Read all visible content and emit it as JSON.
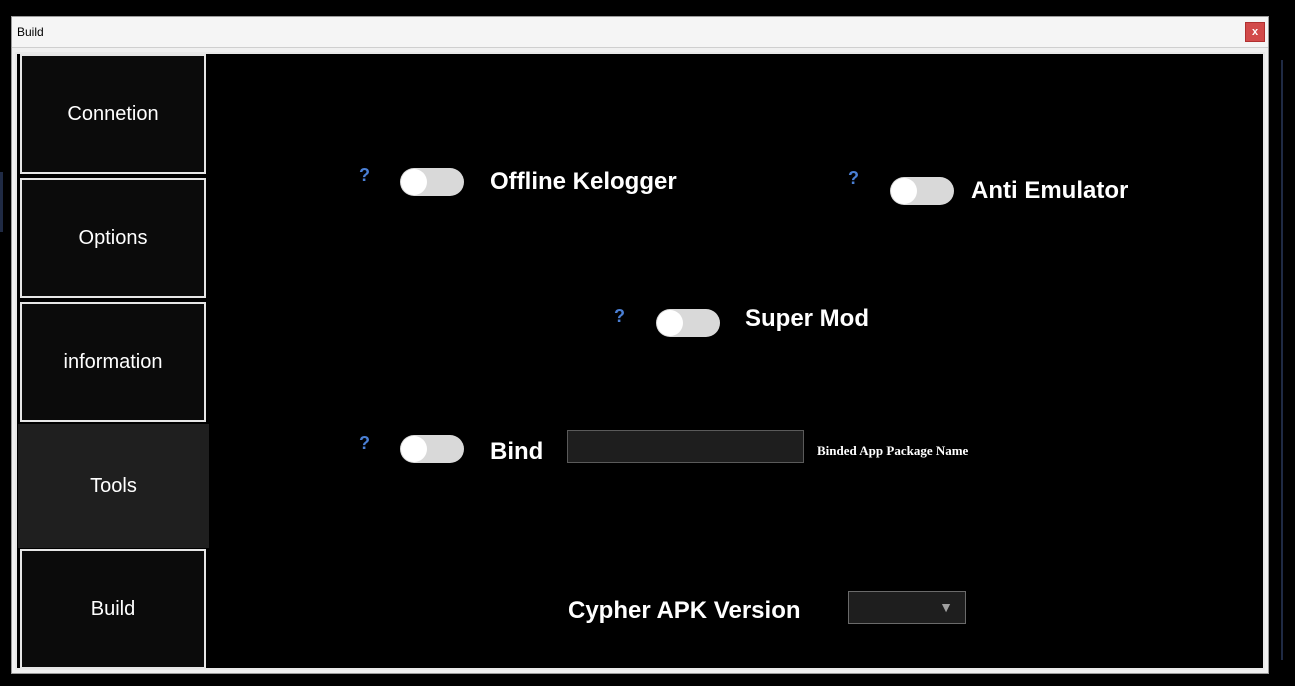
{
  "window": {
    "title": "Build",
    "close_label": "x"
  },
  "sidebar": {
    "items": [
      {
        "label": "Connetion",
        "active": false
      },
      {
        "label": "Options",
        "active": false
      },
      {
        "label": "information",
        "active": false
      },
      {
        "label": "Tools",
        "active": true
      },
      {
        "label": "Build",
        "active": false
      }
    ]
  },
  "main": {
    "help_glyph": "?",
    "options": {
      "offline_keylogger": {
        "label": "Offline Kelogger",
        "enabled": false
      },
      "anti_emulator": {
        "label": "Anti Emulator",
        "enabled": false
      },
      "super_mod": {
        "label": "Super Mod",
        "enabled": false
      },
      "bind": {
        "label": "Bind",
        "enabled": false
      }
    },
    "bind_input": {
      "value": "",
      "caption": "Binded App Package Name"
    },
    "version": {
      "label": "Cypher APK Version",
      "selected": "",
      "arrow_icon": "triangle-down-icon"
    }
  },
  "colors": {
    "help": "#4a7fd4",
    "close_button": "#d24a4a",
    "toggle_off": "#d9d9d9",
    "active_nav": "#1f1f1f"
  }
}
